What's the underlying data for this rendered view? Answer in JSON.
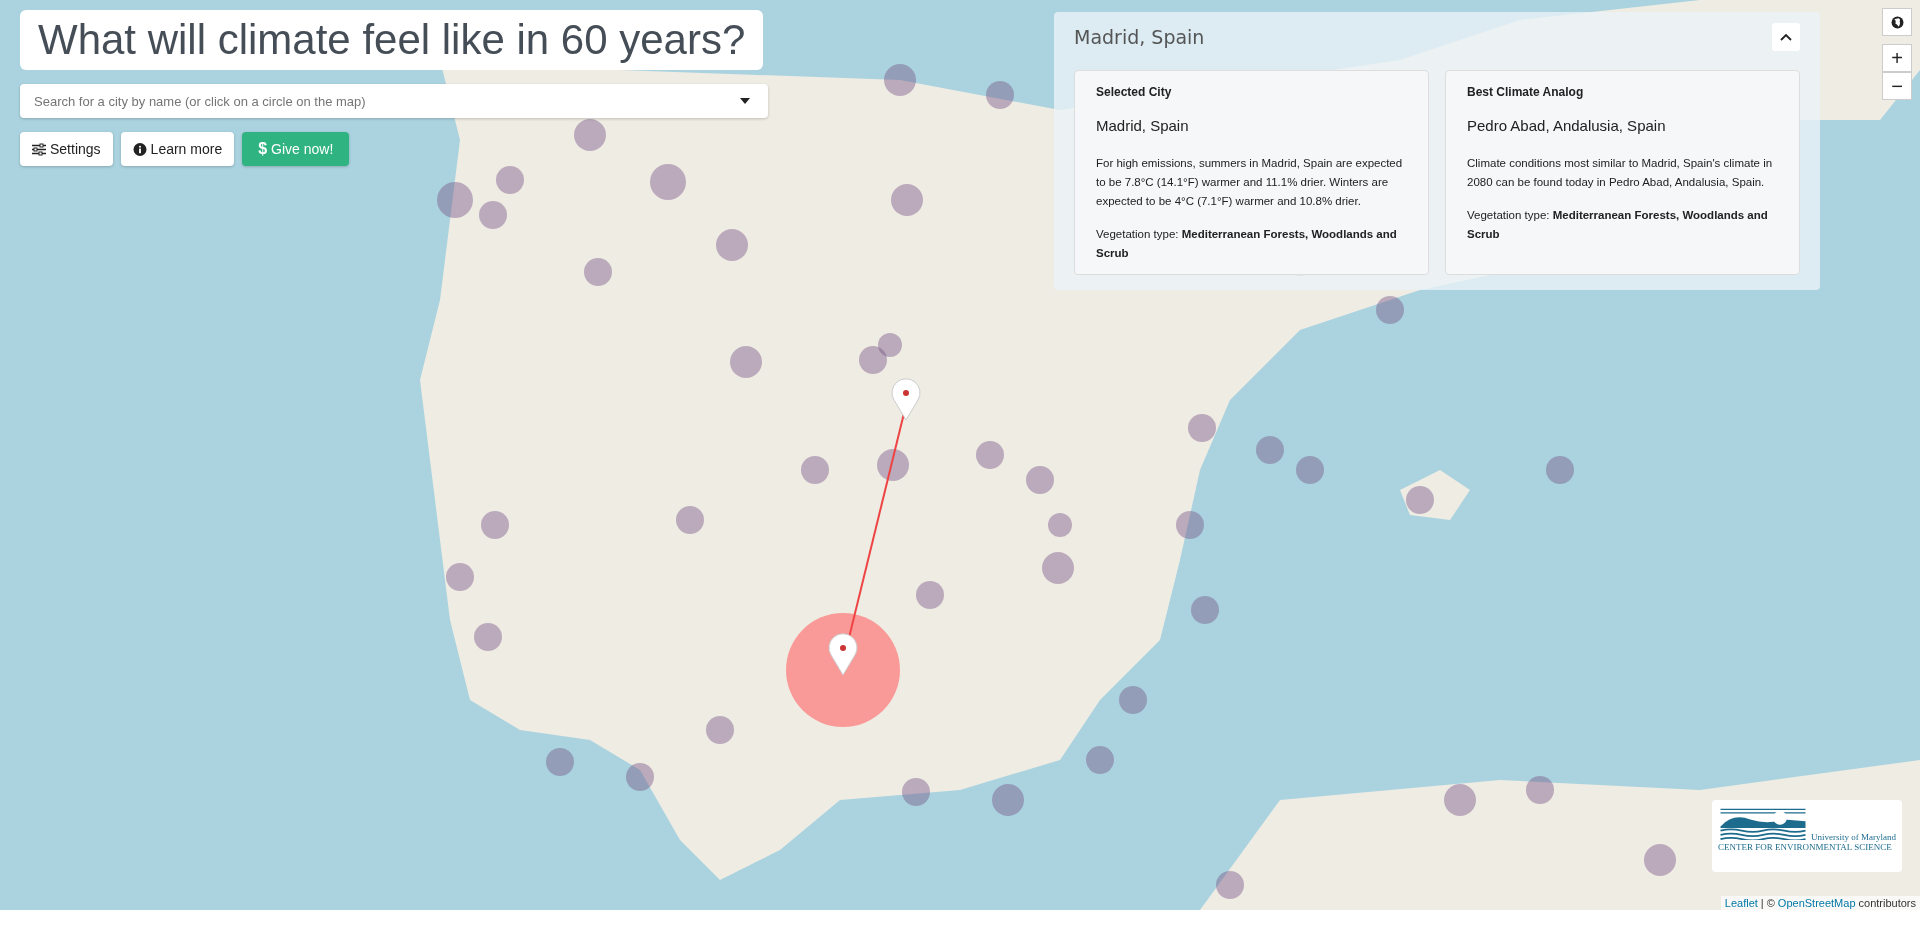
{
  "header": {
    "title": "What will climate feel like in 60 years?"
  },
  "search": {
    "placeholder": "Search for a city by name (or click on a circle on the map)"
  },
  "buttons": [
    {
      "kind": "settings",
      "label": "Settings"
    },
    {
      "kind": "info",
      "label": "Learn more"
    },
    {
      "kind": "donate",
      "label": "Give now!",
      "icon_text": "$"
    }
  ],
  "panel": {
    "title": "Madrid, Spain",
    "expanded": true,
    "cards": [
      {
        "heading": "Selected City",
        "city": "Madrid, Spain",
        "description": "For high emissions, summers in Madrid, Spain are expected to be 7.8°C (14.1°F) warmer and 11.1% drier. Winters are expected to be 4°C (7.1°F) warmer and 10.8% drier.",
        "vegetation": "Vegetation type: **Mediterranean Forests, Woodlands and Scrub**"
      },
      {
        "heading": "Best Climate Analog",
        "city": "Pedro Abad, Andalusia, Spain",
        "description": "Climate conditions most similar to Madrid, Spain's climate in 2080 can be found today in Pedro Abad, Andalusia, Spain.",
        "vegetation": "Vegetation type: **Mediterranean Forests, Woodlands and Scrub**"
      }
    ]
  },
  "map_controls": {
    "zoom_in": "+",
    "zoom_out": "−"
  },
  "logo": {
    "line_1": "University of Maryland",
    "line_2": "CENTER FOR ENVIRONMENTAL SCIENCE"
  },
  "attribution": {
    "link_1": "Leaflet",
    "separator": "| ©",
    "link_2": "OpenStreetMap",
    "suffix": "contributors"
  }
}
